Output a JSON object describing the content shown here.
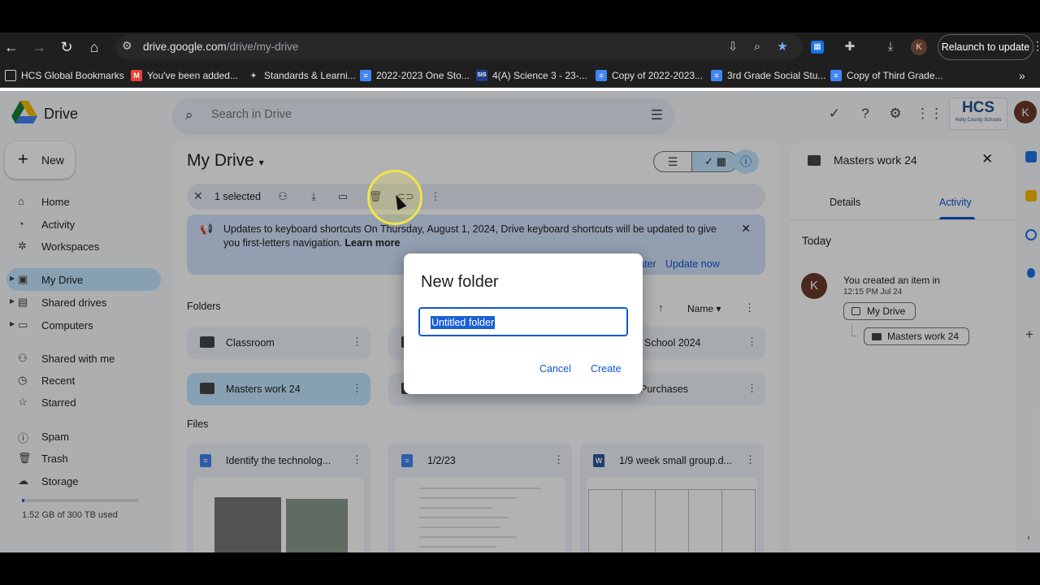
{
  "browser": {
    "url_host": "drive.google.com",
    "url_path": "/drive/my-drive",
    "profile_initial": "K",
    "relaunch_label": "Relaunch to update",
    "bookmarks": [
      "HCS Global Bookmarks",
      "You've been added...",
      "Standards & Learni...",
      "2022-2023 One Sto...",
      "4(A) Science 3  - 23-...",
      "Copy of 2022-2023...",
      "3rd Grade Social Stu...",
      "Copy of Third Grade..."
    ],
    "sis_badge": "SIS"
  },
  "drive": {
    "title": "Drive",
    "search_placeholder": "Search in Drive",
    "hcs_logo": "HCS",
    "hcs_sub": "Holly County Schools",
    "avatar_initial": "K",
    "new_label": "New",
    "sidebar": [
      "Home",
      "Activity",
      "Workspaces",
      "My Drive",
      "Shared drives",
      "Computers",
      "Shared with me",
      "Recent",
      "Starred",
      "Spam",
      "Trash",
      "Storage"
    ],
    "storage_text": "1.52 GB of 300 TB used",
    "storage_used_fraction": 0.01
  },
  "main": {
    "title": "My Drive",
    "selected_text": "1 selected",
    "banner_heading": "Updates to keyboard shortcuts",
    "banner_text": " On Thursday, August 1, 2024, Drive keyboard shortcuts will be updated to give you first-letters navigation. ",
    "banner_link": "Learn more",
    "banner_later": "Remind me later",
    "banner_update": "Update now",
    "folders_label": "Folders",
    "sort_label": "Name",
    "files_label": "Files",
    "folders": [
      "Classroom",
      "School 2024",
      "Masters work 24",
      "Purchases"
    ],
    "files": [
      "Identify the technolog...",
      "1/2/23",
      "1/9 week small group.d..."
    ],
    "file_type_word": "W"
  },
  "panel": {
    "title": "Masters work 24",
    "tab_details": "Details",
    "tab_activity": "Activity",
    "today": "Today",
    "avatar_initial": "K",
    "activity_text": "You created an item in",
    "activity_time": "12:15 PM Jul 24",
    "chip_parent": "My Drive",
    "chip_child": "Masters work 24"
  },
  "dialog": {
    "title": "New folder",
    "value": "Untitled folder",
    "cancel": "Cancel",
    "create": "Create"
  },
  "colors": {
    "accent": "#0b57d0",
    "selected": "#c2e7ff",
    "cursor_ring": "#f0e44a"
  }
}
